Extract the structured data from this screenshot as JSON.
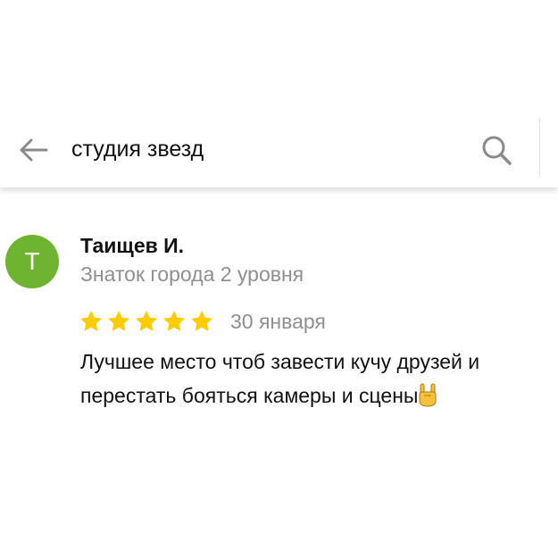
{
  "search": {
    "query": "студия звезд"
  },
  "review": {
    "avatar_letter": "Т",
    "author_name": "Таищев И.",
    "author_level": "Знаток города 2 уровня",
    "rating": 5,
    "rating_max": 5,
    "date": "30 января",
    "text_line1": "Лучшее место чтоб завести кучу друзей и",
    "text_line2": "перестать бояться камеры и сцены",
    "emoji": "rock-on-hand-emoji"
  },
  "colors": {
    "avatar_bg": "#6fb430",
    "star": "#ffcc00",
    "secondary_text": "#8f8f8f",
    "icon_gray": "#8a8a8a"
  },
  "icons": {
    "back": "arrow-left-icon",
    "search": "search-icon",
    "star": "star-icon"
  }
}
